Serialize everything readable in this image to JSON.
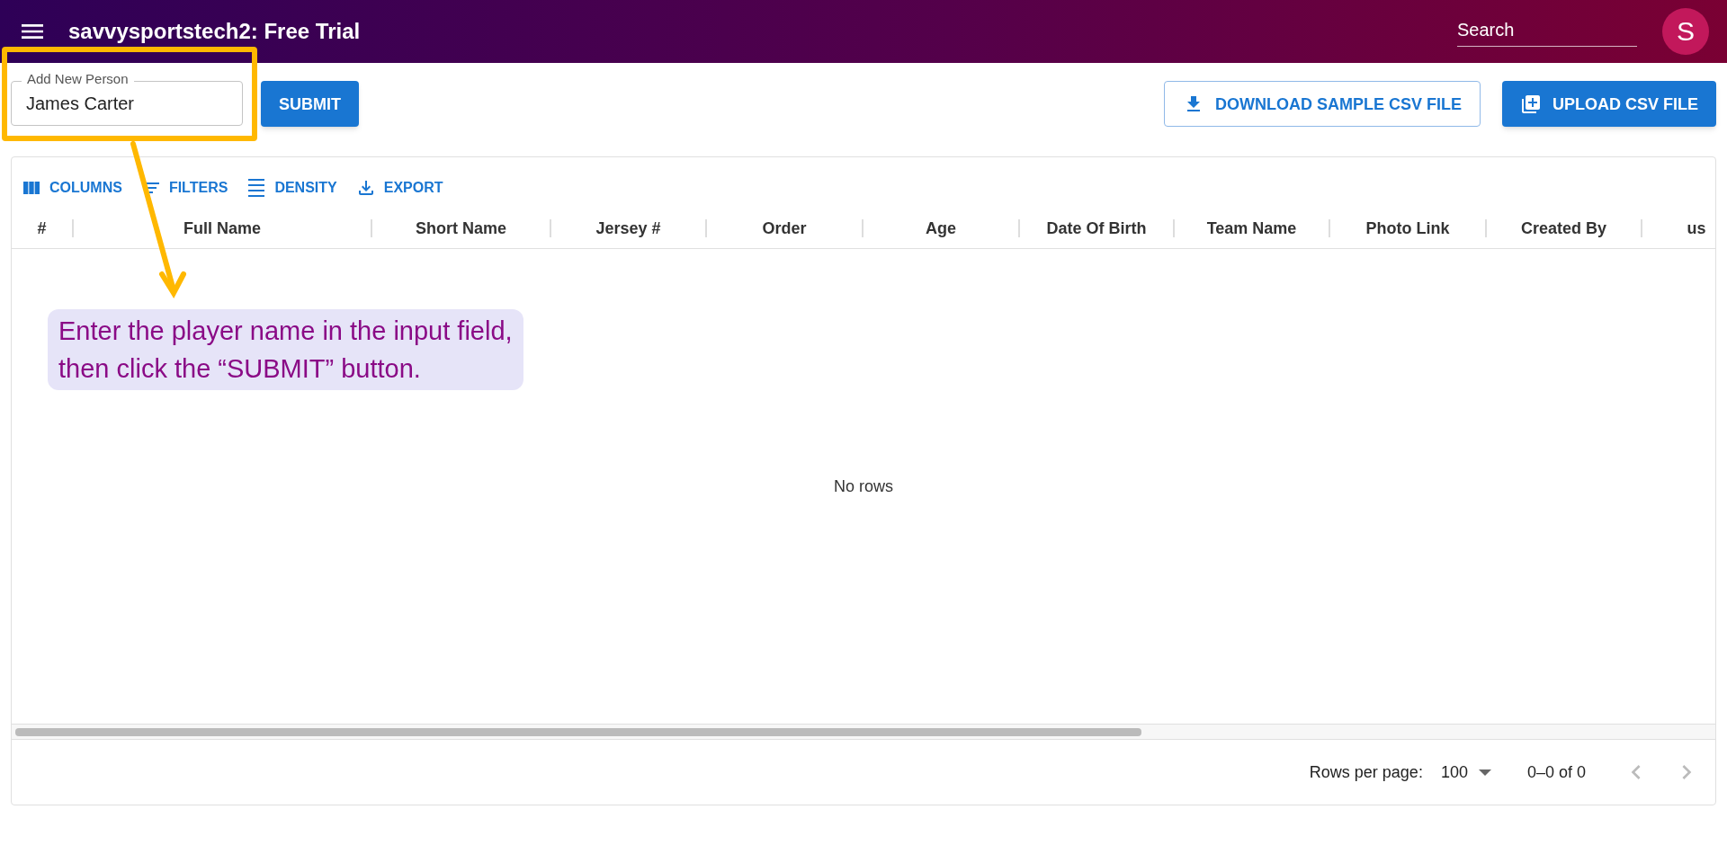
{
  "app_bar": {
    "title": "savvysportstech2: Free Trial",
    "search": {
      "placeholder": "Search"
    },
    "avatar": "S"
  },
  "add_person": {
    "label": "Add New Person",
    "value": "James Carter",
    "submit": "SUBMIT"
  },
  "actions": [
    {
      "label": "DOWNLOAD SAMPLE CSV FILE",
      "kind": "outlined"
    },
    {
      "label": "UPLOAD CSV FILE",
      "kind": "contained"
    }
  ],
  "toolbar": [
    {
      "label": "COLUMNS",
      "kind": "columns"
    },
    {
      "label": "FILTERS",
      "kind": "filters"
    },
    {
      "label": "DENSITY",
      "kind": "density"
    },
    {
      "label": "EXPORT",
      "kind": "export"
    }
  ],
  "table": {
    "columns": [
      "#",
      "Full Name",
      "Short Name",
      "Jersey #",
      "Order",
      "Age",
      "Date Of Birth",
      "Team Name",
      "Photo Link",
      "Created By",
      "us"
    ],
    "empty_message": "No rows"
  },
  "pagination": {
    "rows_per_page_label": "Rows per page:",
    "rows_per_page": "100",
    "range": "0–0 of 0",
    "prev": {
      "disabled": true
    },
    "next": {
      "disabled": true
    }
  },
  "annotation": {
    "text": "Enter the player name in the input field,\nthen click the “SUBMIT” button."
  }
}
